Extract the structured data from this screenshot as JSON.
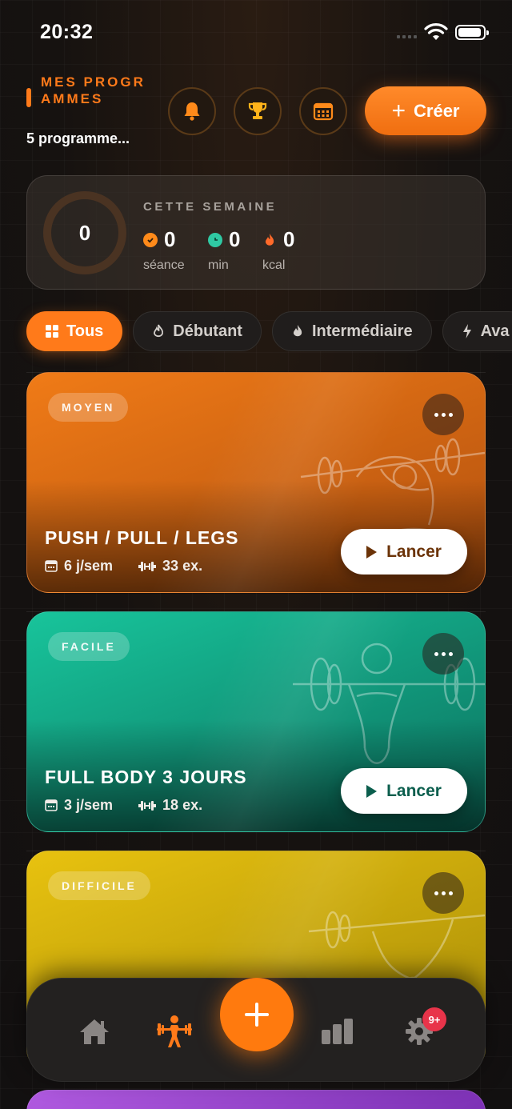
{
  "status_bar": {
    "time": "20:32"
  },
  "header": {
    "title": "MES PROGRAMMES",
    "subtitle": "5 programme...",
    "create_label": "Créer"
  },
  "week": {
    "label": "CETTE SEMAINE",
    "ring_value": "0",
    "stats": [
      {
        "value": "0",
        "unit": "séance",
        "icon": "check-icon",
        "color": "#ff8a1a"
      },
      {
        "value": "0",
        "unit": "min",
        "icon": "clock-icon",
        "color": "#2fc9a3"
      },
      {
        "value": "0",
        "unit": "kcal",
        "icon": "flame-icon",
        "color": "#ff6a2a"
      }
    ]
  },
  "filters": [
    {
      "label": "Tous",
      "icon": "grid-icon",
      "active": true
    },
    {
      "label": "Débutant",
      "icon": "flame-outline-icon",
      "active": false
    },
    {
      "label": "Intermédiaire",
      "icon": "flame-icon",
      "active": false
    },
    {
      "label": "Ava",
      "icon": "bolt-icon",
      "active": false
    }
  ],
  "programs": [
    {
      "badge": "MOYEN",
      "name": "PUSH / PULL / LEGS",
      "days": "6 j/sem",
      "exercises": "33 ex.",
      "launch": "Lancer",
      "gradient": [
        "#f07b17",
        "#b04f0e"
      ],
      "accent": "#6b3308"
    },
    {
      "badge": "FACILE",
      "name": "FULL BODY 3 JOURS",
      "days": "3 j/sem",
      "exercises": "18 ex.",
      "launch": "Lancer",
      "gradient": [
        "#18c49b",
        "#0b6f5d"
      ],
      "accent": "#0b5e4d"
    },
    {
      "badge": "DIFFICILE",
      "name": "",
      "days": "",
      "exercises": "",
      "launch": "",
      "gradient": [
        "#e8c20f",
        "#a58a08"
      ],
      "accent": "#6b5a05"
    }
  ],
  "tabbar": {
    "items": [
      "home-icon",
      "workout-icon",
      "add-icon",
      "stats-icon",
      "settings-icon"
    ],
    "notification_badge": "9+"
  },
  "colors": {
    "accent": "#ff7a1a",
    "background": "#141110"
  }
}
